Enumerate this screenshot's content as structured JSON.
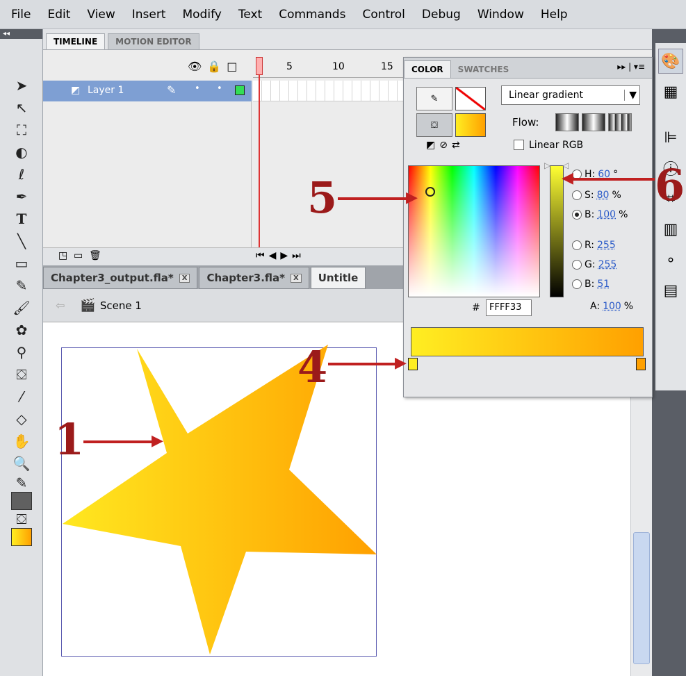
{
  "menu": [
    "File",
    "Edit",
    "View",
    "Insert",
    "Modify",
    "Text",
    "Commands",
    "Control",
    "Debug",
    "Window",
    "Help"
  ],
  "timeline": {
    "tabs": [
      "TIMELINE",
      "MOTION EDITOR"
    ],
    "layer_name": "Layer 1",
    "ruler": [
      "5",
      "10",
      "15"
    ]
  },
  "doc_tabs": [
    {
      "label": "Chapter3_output.fla*",
      "close": "X"
    },
    {
      "label": "Chapter3.fla*",
      "close": "X"
    },
    {
      "label": "Untitle"
    }
  ],
  "scene": {
    "label": "Scene 1"
  },
  "color_panel": {
    "tabs": [
      "COLOR",
      "SWATCHES"
    ],
    "fill_type": "Linear gradient",
    "flow_label": "Flow:",
    "linear_rgb_label": "Linear RGB",
    "hex_prefix": "#",
    "hex_value": "FFFF33",
    "hsb": [
      {
        "label": "H:",
        "value": "60",
        "unit": "°"
      },
      {
        "label": "S:",
        "value": "80",
        "unit": "%"
      },
      {
        "label": "B:",
        "value": "100",
        "unit": "%"
      }
    ],
    "rgb": [
      {
        "label": "R:",
        "value": "255"
      },
      {
        "label": "G:",
        "value": "255"
      },
      {
        "label": "B:",
        "value": "51"
      }
    ],
    "alpha": {
      "label": "A:",
      "value": "100",
      "unit": "%"
    },
    "selected_mode": "B",
    "gradient_start": "#ffee22",
    "gradient_end": "#ffa000"
  },
  "annotations": [
    "1",
    "4",
    "5",
    "6"
  ],
  "colors": {
    "star_start": "#ffe820",
    "star_end": "#ffa000",
    "annotation": "#9b1a1a"
  }
}
